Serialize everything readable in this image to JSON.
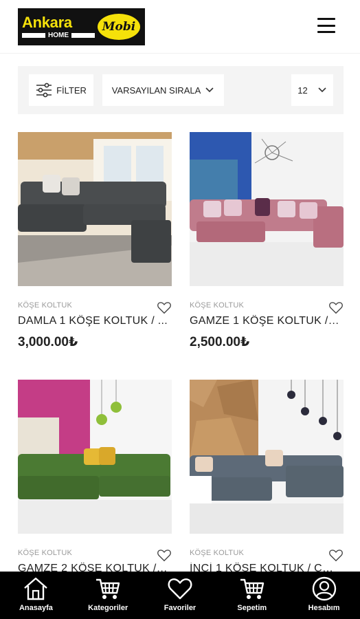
{
  "brand": {
    "name": "Ankara",
    "sub": "HOME",
    "badge": "Mobi",
    "colors": {
      "yellow": "#f5e10a",
      "black": "#111111"
    }
  },
  "header": {
    "menu_icon": "hamburger-menu-icon"
  },
  "toolbar": {
    "filter_label": "FİLTER",
    "sort_label": "VARSAYILAN SIRALA",
    "count_value": "12"
  },
  "products": [
    {
      "category": "KÖŞE KOLTUK",
      "name": "DAMLA 1 KÖŞE KOLTUK / ...",
      "price": "3,000.00₺"
    },
    {
      "category": "KÖŞE KOLTUK",
      "name": "GAMZE 1 KÖŞE KOLTUK / ...",
      "price": "2,500.00₺"
    },
    {
      "category": "KÖŞE KOLTUK",
      "name": "GAMZE 2 KÖŞE KOLTUK / ..."
    },
    {
      "category": "KÖŞE KOLTUK",
      "name": "İNCİ 1 KÖŞE KOLTUK / CO..."
    }
  ],
  "bottom_nav": [
    {
      "label": "Anasayfa",
      "icon": "home-icon"
    },
    {
      "label": "Kategoriler",
      "icon": "cart-icon"
    },
    {
      "label": "Favoriler",
      "icon": "heart-icon"
    },
    {
      "label": "Sepetim",
      "icon": "cart-icon"
    },
    {
      "label": "Hesabım",
      "icon": "user-icon"
    }
  ]
}
